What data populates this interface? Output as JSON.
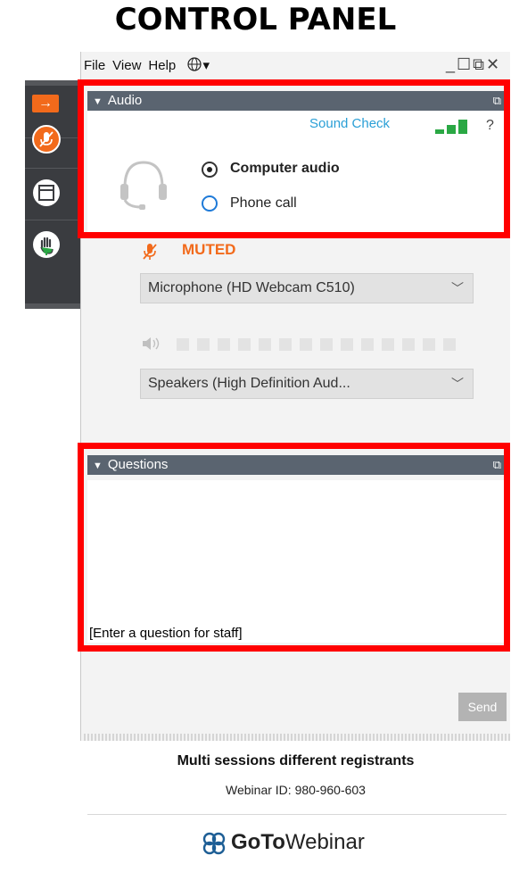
{
  "page_title": "CONTROL PANEL",
  "menu": {
    "file": "File",
    "view": "View",
    "help": "Help",
    "globe_icon": "globe-icon",
    "globe_caret": "▾"
  },
  "window_controls": "_☐⧉✕",
  "audio": {
    "header": "Audio",
    "sound_check": "Sound Check",
    "help": "?",
    "options": {
      "computer": "Computer audio",
      "phone": "Phone call"
    },
    "selected": "Computer audio",
    "status": "MUTED",
    "microphone": "Microphone (HD Webcam C510)",
    "speakers": "Speakers (High Definition Aud...",
    "signal_bars_lit": 3,
    "speaker_level_segments_lit": 0
  },
  "questions": {
    "header": "Questions",
    "placeholder": "[Enter a question for staff]",
    "send": "Send"
  },
  "footer": {
    "session_title": "Multi sessions different registrants",
    "webinar_id": "Webinar ID: 980-960-603",
    "logo_bold": "GoTo",
    "logo_rest": "Webinar"
  },
  "colors": {
    "accent_orange": "#f26a1b",
    "header_gray": "#5a6470",
    "link_blue": "#2a9fd6",
    "signal_green": "#2aa844",
    "highlight_red": "#ff0000"
  }
}
